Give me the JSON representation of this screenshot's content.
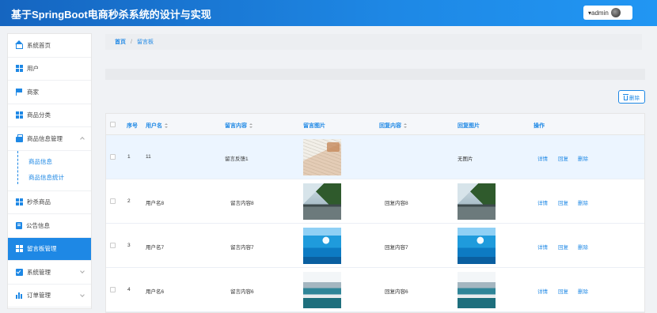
{
  "header": {
    "title": "基于SpringBoot电商秒杀系统的设计与实现",
    "user_label": "▾admin"
  },
  "sidebar": {
    "items": [
      {
        "label": "系统首页",
        "icon": "home-icon"
      },
      {
        "label": "用户",
        "icon": "grid-icon"
      },
      {
        "label": "商家",
        "icon": "flag-icon"
      },
      {
        "label": "商品分类",
        "icon": "grid-icon"
      },
      {
        "label": "商品信息管理",
        "icon": "bag-icon",
        "expanded": true
      },
      {
        "label": "秒杀商品",
        "icon": "grid-icon"
      },
      {
        "label": "公告信息",
        "icon": "clipboard-icon"
      },
      {
        "label": "留言板管理",
        "icon": "grid-icon",
        "active": true
      },
      {
        "label": "系统管理",
        "icon": "check-icon"
      },
      {
        "label": "订单管理",
        "icon": "chart-icon"
      }
    ],
    "submenu": [
      "商品信息",
      "商品信息统计"
    ]
  },
  "breadcrumb": {
    "home": "首页",
    "separator": "/",
    "current": "留言板"
  },
  "toolbar": {
    "delete_label": "删除"
  },
  "table": {
    "headers": {
      "index": "序号",
      "username": "用户名",
      "content": "留言内容",
      "image": "留言图片",
      "reply": "回复内容",
      "reply_image": "回复图片",
      "actions": "操作"
    },
    "rows": [
      {
        "index": "1",
        "username": "11",
        "content": "留言反馈1",
        "image": "notebook-photo",
        "reply": "",
        "reply_image_text": "无图片"
      },
      {
        "index": "2",
        "username": "用户名8",
        "content": "留言内容8",
        "image": "fjord-photo",
        "reply": "回复内容8",
        "reply_image": "fjord-photo"
      },
      {
        "index": "3",
        "username": "用户名7",
        "content": "留言内容7",
        "image": "sea-photo",
        "reply": "回复内容7",
        "reply_image": "sea-photo"
      },
      {
        "index": "4",
        "username": "用户名6",
        "content": "留言内容6",
        "image": "wave-photo",
        "reply": "回复内容6",
        "reply_image": "wave-photo"
      }
    ],
    "actions": {
      "detail": "详情",
      "reply": "回复",
      "delete": "删除"
    }
  },
  "colors": {
    "primary": "#1e88e5",
    "header_start": "#1565c0",
    "highlight_row": "#ecf5ff"
  }
}
